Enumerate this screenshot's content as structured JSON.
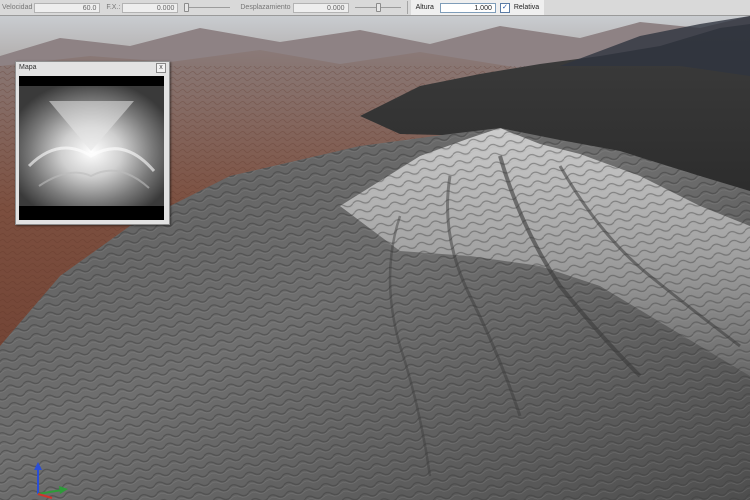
{
  "toolbar": {
    "velocidad_label": "Velocidad",
    "velocidad_value": "60.0",
    "fx_label": "F.X.:",
    "fx_value": "0.000",
    "fx_slider_level": 0.0,
    "desplazamiento_label": "Desplazamiento",
    "desplazamiento_value": "0.000",
    "desplazamiento_slider_level": 0.5,
    "altura_label": "Altura",
    "altura_value": "1.000",
    "relativa_label": "Relativa",
    "relativa_checked": true
  },
  "map_panel": {
    "title": "Mapa",
    "close_glyph": "x"
  },
  "colors": {
    "sky": "#c8cdd2",
    "terrain_far": "#7a4a3a",
    "terrain_mesh": "#8a8a8a",
    "axis_x": "#d0342c",
    "axis_y": "#2e9b3a",
    "axis_z": "#2a4ed6"
  }
}
